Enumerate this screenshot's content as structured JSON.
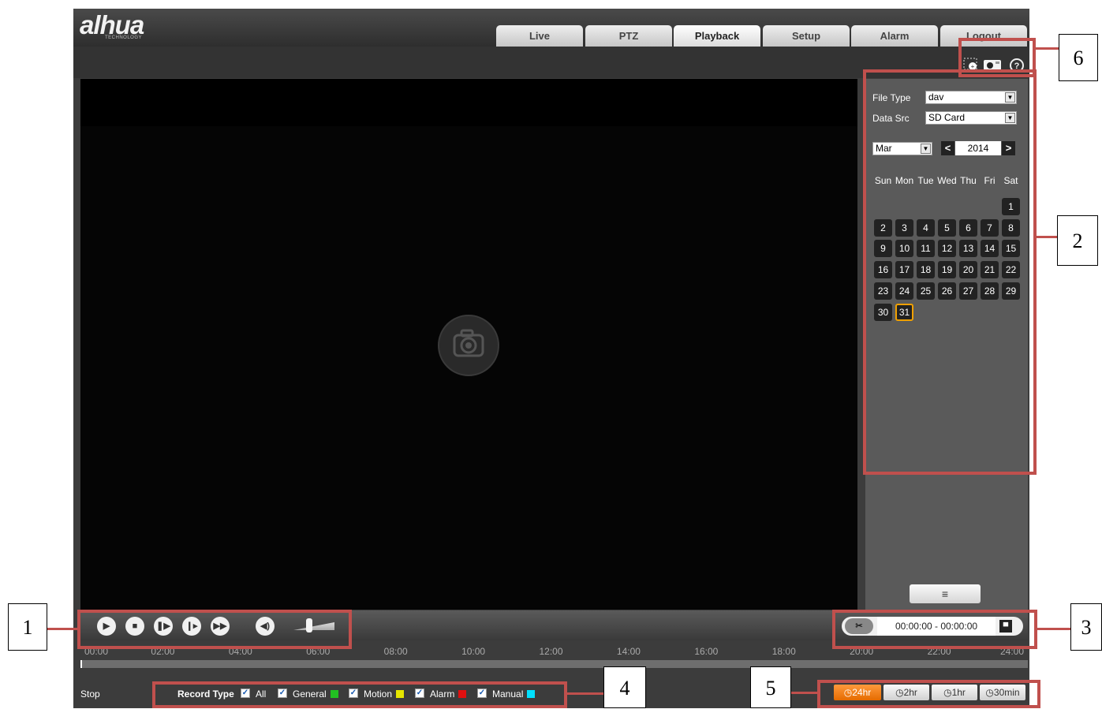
{
  "brand": {
    "logo": "alhua",
    "tagline": "TECHNOLOGY"
  },
  "tabs": [
    "Live",
    "PTZ",
    "Playback",
    "Setup",
    "Alarm",
    "Logout"
  ],
  "active_tab": "Playback",
  "toolbar_icons": [
    "zoom-icon",
    "snapshot-icon",
    "help-icon"
  ],
  "search": {
    "file_type_label": "File Type",
    "file_type_value": "dav",
    "data_src_label": "Data Src",
    "data_src_value": "SD Card",
    "month": "Mar",
    "year": "2014",
    "prev": "<",
    "next": ">"
  },
  "calendar": {
    "weekdays": [
      "Sun",
      "Mon",
      "Tue",
      "Wed",
      "Thu",
      "Fri",
      "Sat"
    ],
    "days": [
      "1",
      "2",
      "3",
      "4",
      "5",
      "6",
      "7",
      "8",
      "9",
      "10",
      "11",
      "12",
      "13",
      "14",
      "15",
      "16",
      "17",
      "18",
      "19",
      "20",
      "21",
      "22",
      "23",
      "24",
      "25",
      "26",
      "27",
      "28",
      "29",
      "30",
      "31"
    ],
    "selected_day": "31"
  },
  "player": {
    "time_range": "00:00:00 - 00:00:00",
    "cut_label": "✂",
    "list_icon": "≡"
  },
  "timeline": {
    "ticks": [
      "00:00",
      "02:00",
      "04:00",
      "06:00",
      "08:00",
      "10:00",
      "12:00",
      "14:00",
      "16:00",
      "18:00",
      "20:00",
      "22:00",
      "24:00"
    ]
  },
  "status": {
    "state": "Stop"
  },
  "record_type": {
    "label": "Record Type",
    "items": [
      {
        "label": "All"
      },
      {
        "label": "General",
        "color": "#22c022"
      },
      {
        "label": "Motion",
        "color": "#e6e600"
      },
      {
        "label": "Alarm",
        "color": "#e01010"
      },
      {
        "label": "Manual",
        "color": "#00e0ff"
      }
    ]
  },
  "zoom": {
    "options": [
      "24hr",
      "2hr",
      "1hr",
      "30min"
    ],
    "active": "24hr"
  },
  "callouts": [
    "1",
    "2",
    "3",
    "4",
    "5",
    "6"
  ],
  "colors": {
    "annotation": "#c0504d",
    "selected_day_border": "#f0a000",
    "active_zoom": "#f07d10"
  }
}
